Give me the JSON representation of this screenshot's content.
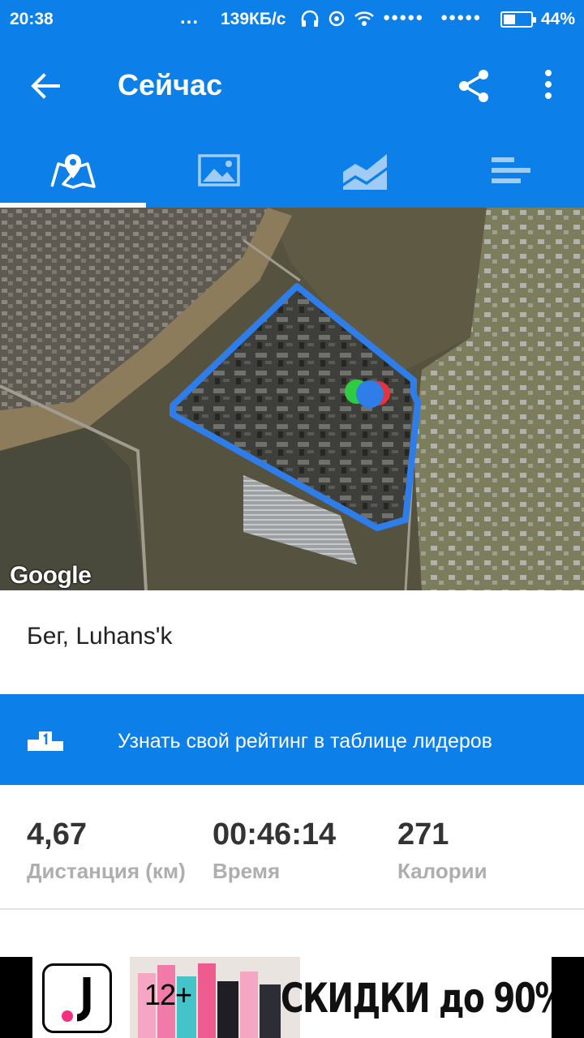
{
  "status_bar": {
    "time": "20:38",
    "dots": "...",
    "speed": "139КБ/с",
    "signal_1": "●●●●●",
    "signal_2": "●●●●●",
    "battery_percent": "44%",
    "battery_level": 0.44
  },
  "app_bar": {
    "title": "Сейчас",
    "back_icon": "arrow-left-icon",
    "share_icon": "share-icon",
    "more_icon": "more-vertical-icon"
  },
  "tabs": [
    {
      "icon": "map-pin-icon",
      "active": true
    },
    {
      "icon": "image-icon",
      "active": false
    },
    {
      "icon": "chart-area-icon",
      "active": false
    },
    {
      "icon": "bars-icon",
      "active": false
    }
  ],
  "map": {
    "attribution": "Google",
    "route_color": "#2f7de9"
  },
  "activity": {
    "title": "Бег, Luhans'k"
  },
  "leaderboard": {
    "label": "Узнать свой рейтинг в таблице лидеров",
    "icon": "podium-icon"
  },
  "stats": [
    {
      "value": "4,67",
      "label": "Дистанция (км)"
    },
    {
      "value": "00:46:14",
      "label": "Время"
    },
    {
      "value": "271",
      "label": "Калории"
    }
  ],
  "ad": {
    "age_rating": "12+",
    "promo": "СКИДКИ до 90%"
  },
  "colors": {
    "primary": "#0d7fe8",
    "stat_label": "#aeaeae"
  }
}
